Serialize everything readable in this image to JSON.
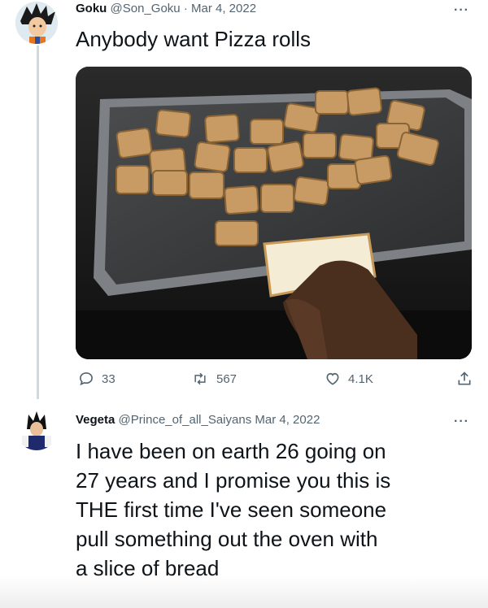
{
  "tweet1": {
    "name": "Goku",
    "handle": "@Son_Goku",
    "separator": "·",
    "date": "Mar 4, 2022",
    "text": "Anybody want Pizza rolls",
    "stats": {
      "replies": "33",
      "retweets": "567",
      "likes": "4.1K"
    }
  },
  "tweet2": {
    "name": "Vegeta",
    "handle": "@Prince_of_all_Saiyans",
    "date": "Mar 4, 2022",
    "text_lines": [
      "I have been on earth 26 going on",
      "27 years and I promise you this is",
      "THE first time I've seen someone",
      "pull something out the oven with",
      "a slice of bread"
    ]
  },
  "icons": {
    "more": "more-icon",
    "reply": "reply-icon",
    "retweet": "retweet-icon",
    "like": "like-icon",
    "share": "share-icon"
  },
  "colors": {
    "text": "#0f1419",
    "secondary": "#536471",
    "thread_line": "#cfd9de"
  }
}
